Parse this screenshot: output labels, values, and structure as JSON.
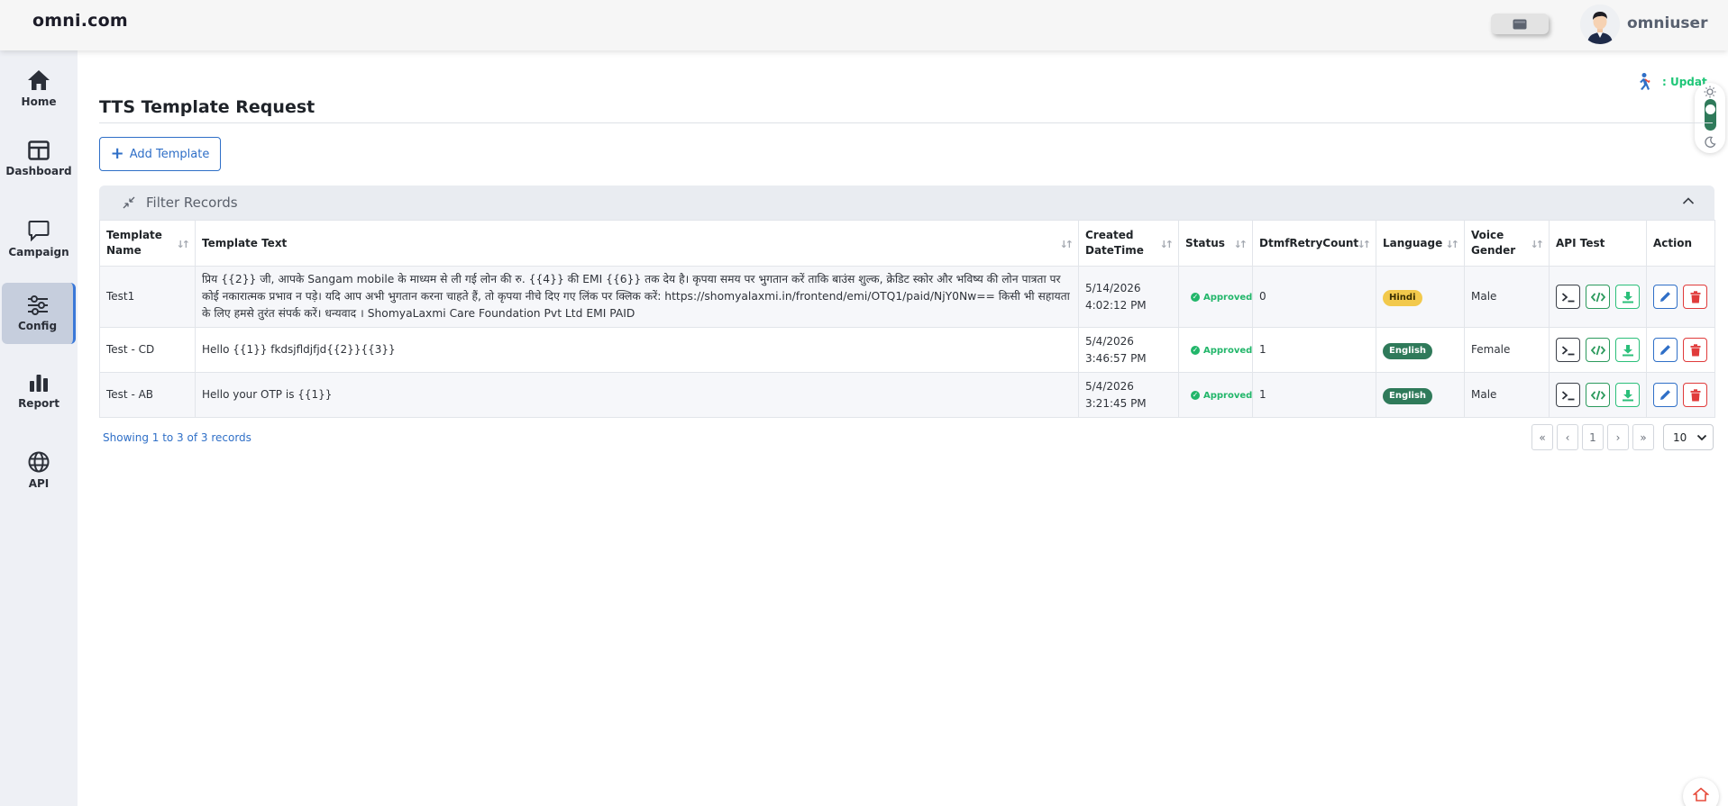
{
  "header": {
    "brand": "omni.com",
    "username": "omniuser"
  },
  "sidebar": {
    "items": [
      {
        "label": "Home",
        "icon": "home-icon"
      },
      {
        "label": "Dashboard",
        "icon": "dashboard-icon"
      },
      {
        "label": "Campaign",
        "icon": "campaign-icon"
      },
      {
        "label": "Config",
        "icon": "config-icon",
        "active": true
      },
      {
        "label": "Report",
        "icon": "report-icon"
      },
      {
        "label": "API",
        "icon": "api-icon"
      }
    ]
  },
  "main": {
    "update_label": ": Updat",
    "page_title": "TTS Template Request",
    "add_button": "Add Template",
    "filter_title": "Filter Records",
    "columns": [
      "Template Name",
      "Template Text",
      "Created DateTime",
      "Status",
      "DtmfRetryCount",
      "Language",
      "Voice Gender",
      "API Test",
      "Action"
    ],
    "rows": [
      {
        "name": "Test1",
        "text": "प्रिय {{2}} जी, आपके Sangam mobile के माध्यम से ली गई लोन की रु. {{4}} की EMI {{6}} तक देय है। कृपया समय पर भुगतान करें ताकि बाउंस शुल्क, क्रेडिट स्कोर और भविष्य की लोन पात्रता पर कोई नकारात्मक प्रभाव न पड़े। यदि आप अभी भुगतान करना चाहते हैं, तो कृपया नीचे दिए गए लिंक पर क्लिक करें: https://shomyalaxmi.in/frontend/emi/OTQ1/paid/NjY0Nw== किसी भी सहायता के लिए हमसे तुरंत संपर्क करें। धन्यवाद । ShomyaLaxmi Care Foundation Pvt Ltd EMI PAID",
        "date": "5/14/2026",
        "time": "4:02:12 PM",
        "status": "Approved",
        "retry": "0",
        "language": "Hindi",
        "gender": "Male"
      },
      {
        "name": "Test - CD",
        "text": "Hello {{1}} fkdsjfldjfjd{{2}}{{3}}",
        "date": "5/4/2026",
        "time": "3:46:57 PM",
        "status": "Approved",
        "retry": "1",
        "language": "English",
        "gender": "Female"
      },
      {
        "name": "Test - AB",
        "text": "Hello your OTP is {{1}}",
        "date": "5/4/2026",
        "time": "3:21:45 PM",
        "status": "Approved",
        "retry": "1",
        "language": "English",
        "gender": "Male"
      }
    ],
    "records_info": "Showing 1 to 3 of 3 records",
    "pagination": {
      "first": "«",
      "prev": "‹",
      "current": "1",
      "next": "›",
      "last": "»"
    },
    "page_size": "10"
  },
  "colors": {
    "accent": "#2f6fc7",
    "approved": "#22b66a",
    "hindi_badge": "#f2c94c",
    "english_badge": "#2f7a5a",
    "delete": "#e03b3b"
  }
}
